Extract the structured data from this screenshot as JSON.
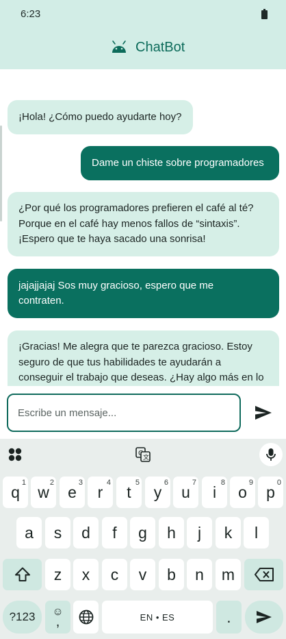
{
  "status": {
    "time": "6:23"
  },
  "app_bar": {
    "title": "ChatBot"
  },
  "messages": [
    {
      "role": "bot",
      "text": "¡Hola! ¿Cómo puedo ayudarte hoy?"
    },
    {
      "role": "user",
      "text": "Dame un chiste sobre programadores"
    },
    {
      "role": "bot",
      "text": "¿Por qué los programadores prefieren el café al té?\nPorque en el café hay menos fallos de “sintaxis”.\n¡Espero que te haya sacado una sonrisa!"
    },
    {
      "role": "user",
      "text": "jajajjajaj Sos muy gracioso, espero que me\ncontraten."
    },
    {
      "role": "bot",
      "text": "¡Gracias! Me alegra que te parezca gracioso. Estoy\nseguro de que tus habilidades te ayudarán a\nconseguir el trabajo que deseas. ¿Hay algo más en lo"
    }
  ],
  "input": {
    "placeholder": "Escribe un mensaje...",
    "value": ""
  },
  "keyboard": {
    "row1": [
      {
        "k": "q",
        "h": "1"
      },
      {
        "k": "w",
        "h": "2"
      },
      {
        "k": "e",
        "h": "3"
      },
      {
        "k": "r",
        "h": "4"
      },
      {
        "k": "t",
        "h": "5"
      },
      {
        "k": "y",
        "h": "6"
      },
      {
        "k": "u",
        "h": "7"
      },
      {
        "k": "i",
        "h": "8"
      },
      {
        "k": "o",
        "h": "9"
      },
      {
        "k": "p",
        "h": "0"
      }
    ],
    "row2": [
      "a",
      "s",
      "d",
      "f",
      "g",
      "h",
      "j",
      "k",
      "l"
    ],
    "row3": [
      "z",
      "x",
      "c",
      "v",
      "b",
      "n",
      "m"
    ],
    "symbols_label": "?123",
    "emoji_comma": {
      "top": "☺",
      "bottom": ","
    },
    "space_label": "EN • ES",
    "period": "."
  },
  "colors": {
    "accent": "#0a705f",
    "bar": "#d2ede6",
    "bot_bubble": "#d6efe7"
  },
  "icons": [
    "battery-icon",
    "android-icon",
    "send-icon",
    "apps-icon",
    "translate-icon",
    "mic-icon",
    "shift-icon",
    "backspace-icon",
    "globe-icon",
    "enter-icon"
  ]
}
